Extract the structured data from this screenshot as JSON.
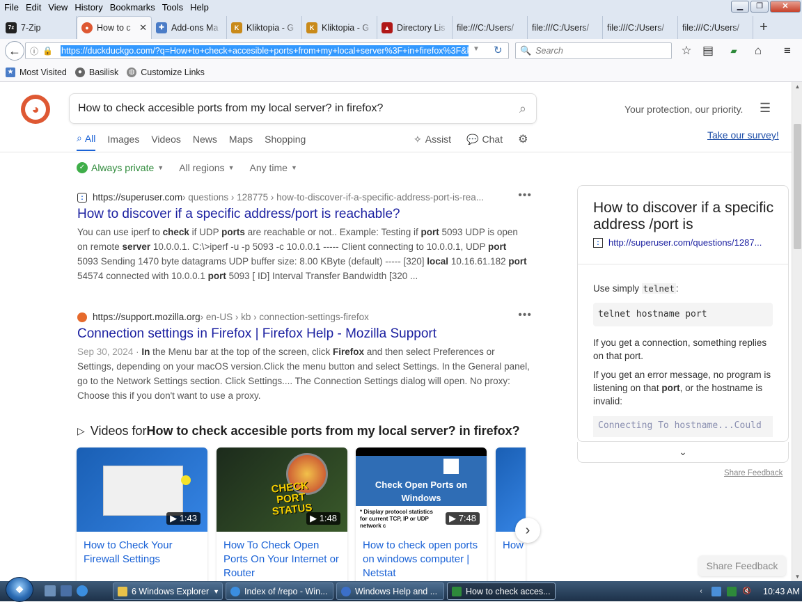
{
  "menubar": {
    "items": [
      {
        "label": "File"
      },
      {
        "label": "Edit"
      },
      {
        "label": "View"
      },
      {
        "label": "History"
      },
      {
        "label": "Bookmarks"
      },
      {
        "label": "Tools"
      },
      {
        "label": "Help"
      }
    ]
  },
  "tabs": [
    {
      "label": "7-Zip",
      "icon": "7zip-icon"
    },
    {
      "label": "How to c",
      "icon": "duckduckgo-icon",
      "active": true
    },
    {
      "label": "Add-ons Ma",
      "icon": "puzzle-icon"
    },
    {
      "label": "Kliktopia - G",
      "icon": "kliktopia-icon"
    },
    {
      "label": "Kliktopia - G",
      "icon": "kliktopia-icon"
    },
    {
      "label": "Directory Lis",
      "icon": "directory-icon"
    },
    {
      "label": "file:///C:/Users/",
      "icon": ""
    },
    {
      "label": "file:///C:/Users/",
      "icon": ""
    },
    {
      "label": "file:///C:/Users/",
      "icon": ""
    },
    {
      "label": "file:///C:/Users/",
      "icon": ""
    }
  ],
  "newtab_label": "+",
  "nav": {
    "url": "https://duckduckgo.com/?q=How+to+check+accesible+ports+from+my+local+server%3F+in+firefox%3F&kp",
    "search_placeholder": "Search"
  },
  "bookmarks": [
    {
      "label": "Most Visited"
    },
    {
      "label": "Basilisk"
    },
    {
      "label": "Customize Links"
    }
  ],
  "page": {
    "query": "How to check accesible ports from my local server? in firefox?",
    "protection_text": "Your protection, our priority.",
    "survey_link": "Take our survey!",
    "search_tabs": [
      {
        "label": "All",
        "active": true
      },
      {
        "label": "Images"
      },
      {
        "label": "Videos"
      },
      {
        "label": "News"
      },
      {
        "label": "Maps"
      },
      {
        "label": "Shopping"
      }
    ],
    "assist_label": "Assist",
    "chat_label": "Chat",
    "filters": {
      "private": "Always private",
      "region": "All regions",
      "time": "Any time"
    },
    "results": [
      {
        "domain": "https://superuser.com",
        "path": " › questions › 128775 › how-to-discover-if-a-specific-address-port-is-rea...",
        "title": "How to discover if a specific address/port is reachable?",
        "snippet_html": "You can use iperf to <b>check</b> if UDP <b>ports</b> are reachable or not.. Example: Testing if <b>port</b> 5093 UDP is open on remote <b>server</b> 10.0.0.1. C:\\>iperf -u -p 5093 -c 10.0.0.1 ----- Client connecting to 10.0.0.1, UDP <b>port</b> 5093 Sending 1470 byte datagrams UDP buffer size: 8.00 KByte (default) ----- [320] <b>local</b> 10.16.61.182 <b>port</b> 54574 connected with 10.0.0.1 <b>port</b> 5093 [ ID] Interval Transfer Bandwidth [320 ..."
      },
      {
        "domain": "https://support.mozilla.org",
        "path": " › en-US › kb › connection-settings-firefox",
        "title": "Connection settings in Firefox | Firefox Help - Mozilla Support",
        "date": "Sep 30, 2024 · ",
        "snippet_html": "<b>In</b> the Menu bar at the top of the screen, click <b>Firefox</b> and then select Preferences or Settings, depending on your macOS version.Click the menu button and select Settings. In the General panel, go to the Network Settings section. Click Settings.... The Connection Settings dialog will open. No proxy: Choose this if you don't want to use a proxy."
      }
    ],
    "videos_header_prefix": "Videos for ",
    "videos_header_query": "How to check accesible ports from my local server? in firefox?",
    "videos": [
      {
        "title": "How to Check Your Firewall Settings",
        "duration": "1:43"
      },
      {
        "title": "How To Check Open Ports On Your Internet or Router",
        "duration": "1:48",
        "thumb_text": "CHECK PORT STATUS"
      },
      {
        "title": "How to check open ports on windows computer | Netstat",
        "duration": "7:48",
        "thumb_text": "Check Open Ports on Windows",
        "thumb_sub": "* Display protocol statistics for current TCP, IP or UDP network c"
      },
      {
        "title": "How servi whic",
        "duration": ""
      }
    ],
    "infobox": {
      "title": "How to discover if a specific address /port is",
      "link": "http://superuser.com/questions/1287...",
      "use_simply": "Use simply ",
      "use_simply_code": "telnet",
      "use_simply_end": ":",
      "code": "telnet hostname port",
      "para1": "If you get a connection, something replies on that port.",
      "para2_html": "If you get an error message, no program is listening on that <b>port</b>, or the hostname is invalid:",
      "code2": "Connecting To hostname...Could"
    },
    "share_feedback_small": "Share Feedback",
    "share_feedback_button": "Share Feedback"
  },
  "taskbar": {
    "buttons": [
      {
        "label": "6 Windows Explorer"
      },
      {
        "label": "Index of /repo - Win..."
      },
      {
        "label": "Windows Help and ..."
      },
      {
        "label": "How to check acces...",
        "active": true
      }
    ],
    "clock": "10:43 AM"
  },
  "colors": {
    "link_blue": "#1a1fa0",
    "tab_blue": "#1a62d6",
    "ddg_orange": "#de5833",
    "private_green": "#3fae49",
    "url_highlight": "#3399ff"
  }
}
